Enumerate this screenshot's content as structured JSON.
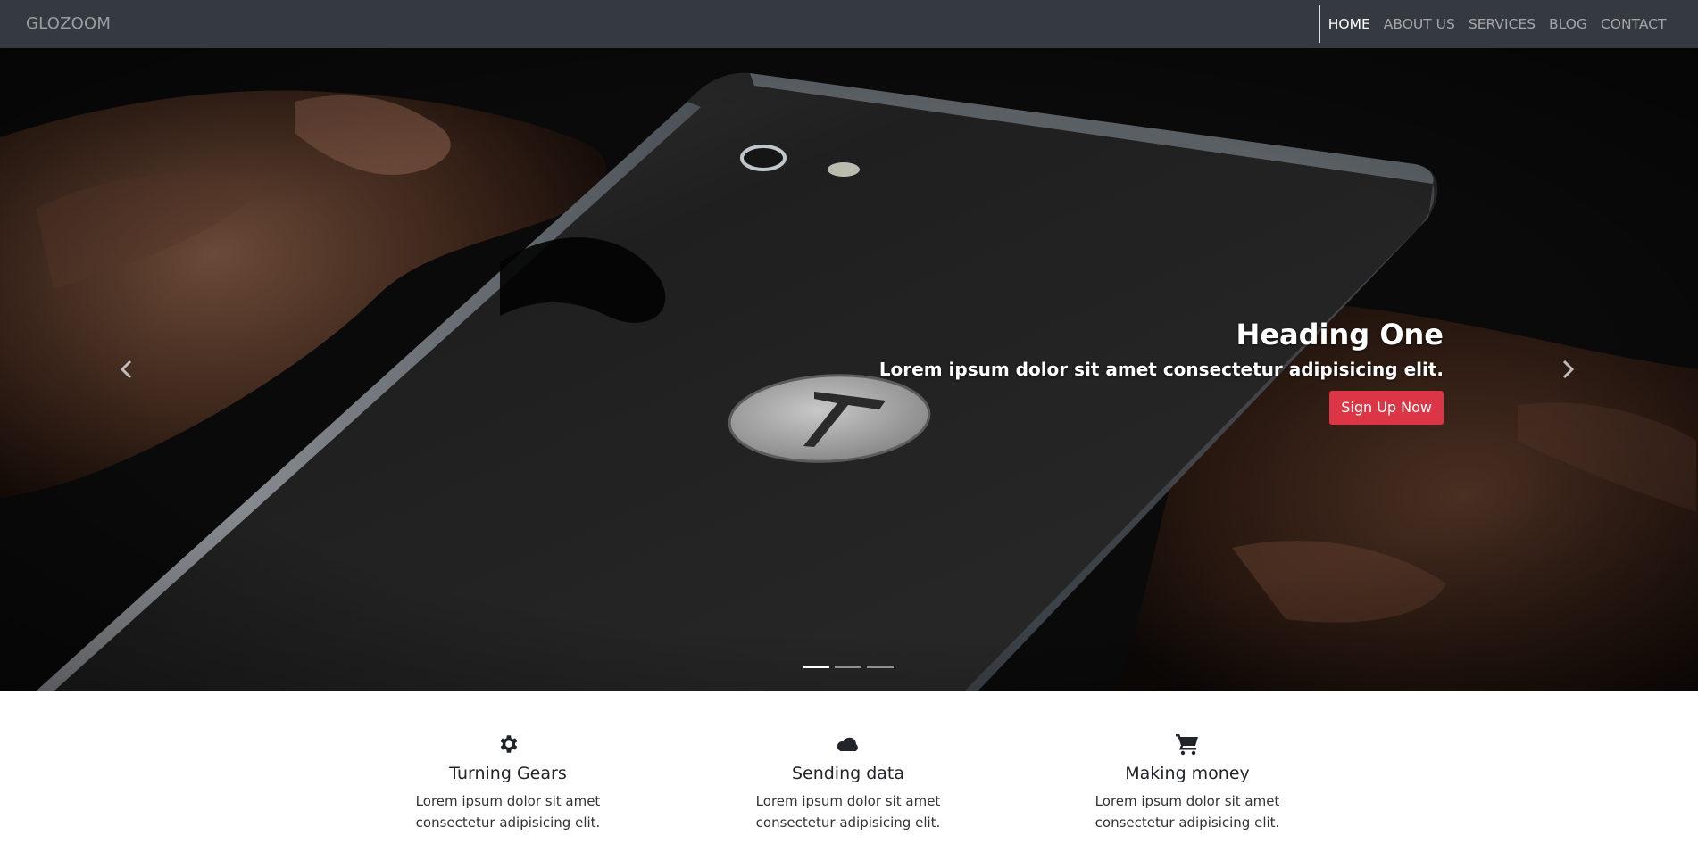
{
  "navbar": {
    "brand": "GLOZOOM",
    "links": [
      {
        "label": "HOME",
        "active": true
      },
      {
        "label": "ABOUT US",
        "active": false
      },
      {
        "label": "SERVICES",
        "active": false
      },
      {
        "label": "BLOG",
        "active": false
      },
      {
        "label": "CONTACT",
        "active": false
      }
    ]
  },
  "hero": {
    "heading": "Heading One",
    "subheading": "Lorem ipsum dolor sit amet consectetur adipisicing elit.",
    "cta_label": "Sign Up Now",
    "slide_count": 3,
    "active_slide": 1,
    "prev_icon": "chevron-left-icon",
    "next_icon": "chevron-right-icon"
  },
  "features": [
    {
      "icon": "gear-icon",
      "title": "Turning Gears",
      "text": "Lorem ipsum dolor sit amet consectetur adipisicing elit."
    },
    {
      "icon": "cloud-icon",
      "title": "Sending data",
      "text": "Lorem ipsum dolor sit amet consectetur adipisicing elit."
    },
    {
      "icon": "cart-icon",
      "title": "Making money",
      "text": "Lorem ipsum dolor sit amet consectetur adipisicing elit."
    }
  ],
  "colors": {
    "navbar_bg": "#343a40",
    "cta_bg": "#dc3545",
    "text_dark": "#212529"
  }
}
